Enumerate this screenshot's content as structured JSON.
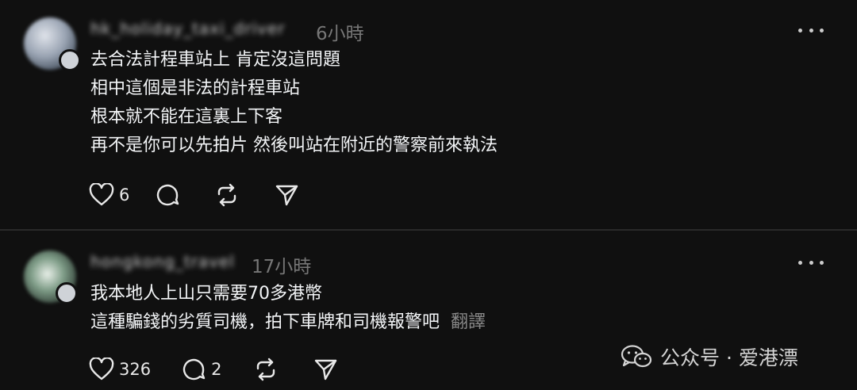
{
  "posts": [
    {
      "username": "hk_holiday_taxi_driver",
      "time": "6小時",
      "lines": [
        "去合法計程車站上 肯定沒這問題",
        "相中這個是非法的計程車站",
        "根本就不能在這裏上下客",
        "再不是你可以先拍片 然後叫站在附近的警察前來執法"
      ],
      "likes": "6",
      "replies": "",
      "translate": ""
    },
    {
      "username": "hongkong_travel",
      "time": "17小時",
      "lines": [
        "我本地人上山只需要70多港幣",
        "這種騙錢的劣質司機，拍下車牌和司機報警吧"
      ],
      "likes": "326",
      "replies": "2",
      "translate": "翻譯"
    }
  ],
  "watermark": {
    "text": "公众号 · 爱港漂",
    "icon": "wechat-icon"
  },
  "icons": {
    "like": "heart-icon",
    "reply": "comment-icon",
    "repost": "repost-icon",
    "share": "send-icon",
    "more": "more-icon"
  },
  "colors": {
    "background": "#101010",
    "text": "#f3f5f7",
    "muted": "#777777",
    "divider": "#2a2a2a"
  }
}
